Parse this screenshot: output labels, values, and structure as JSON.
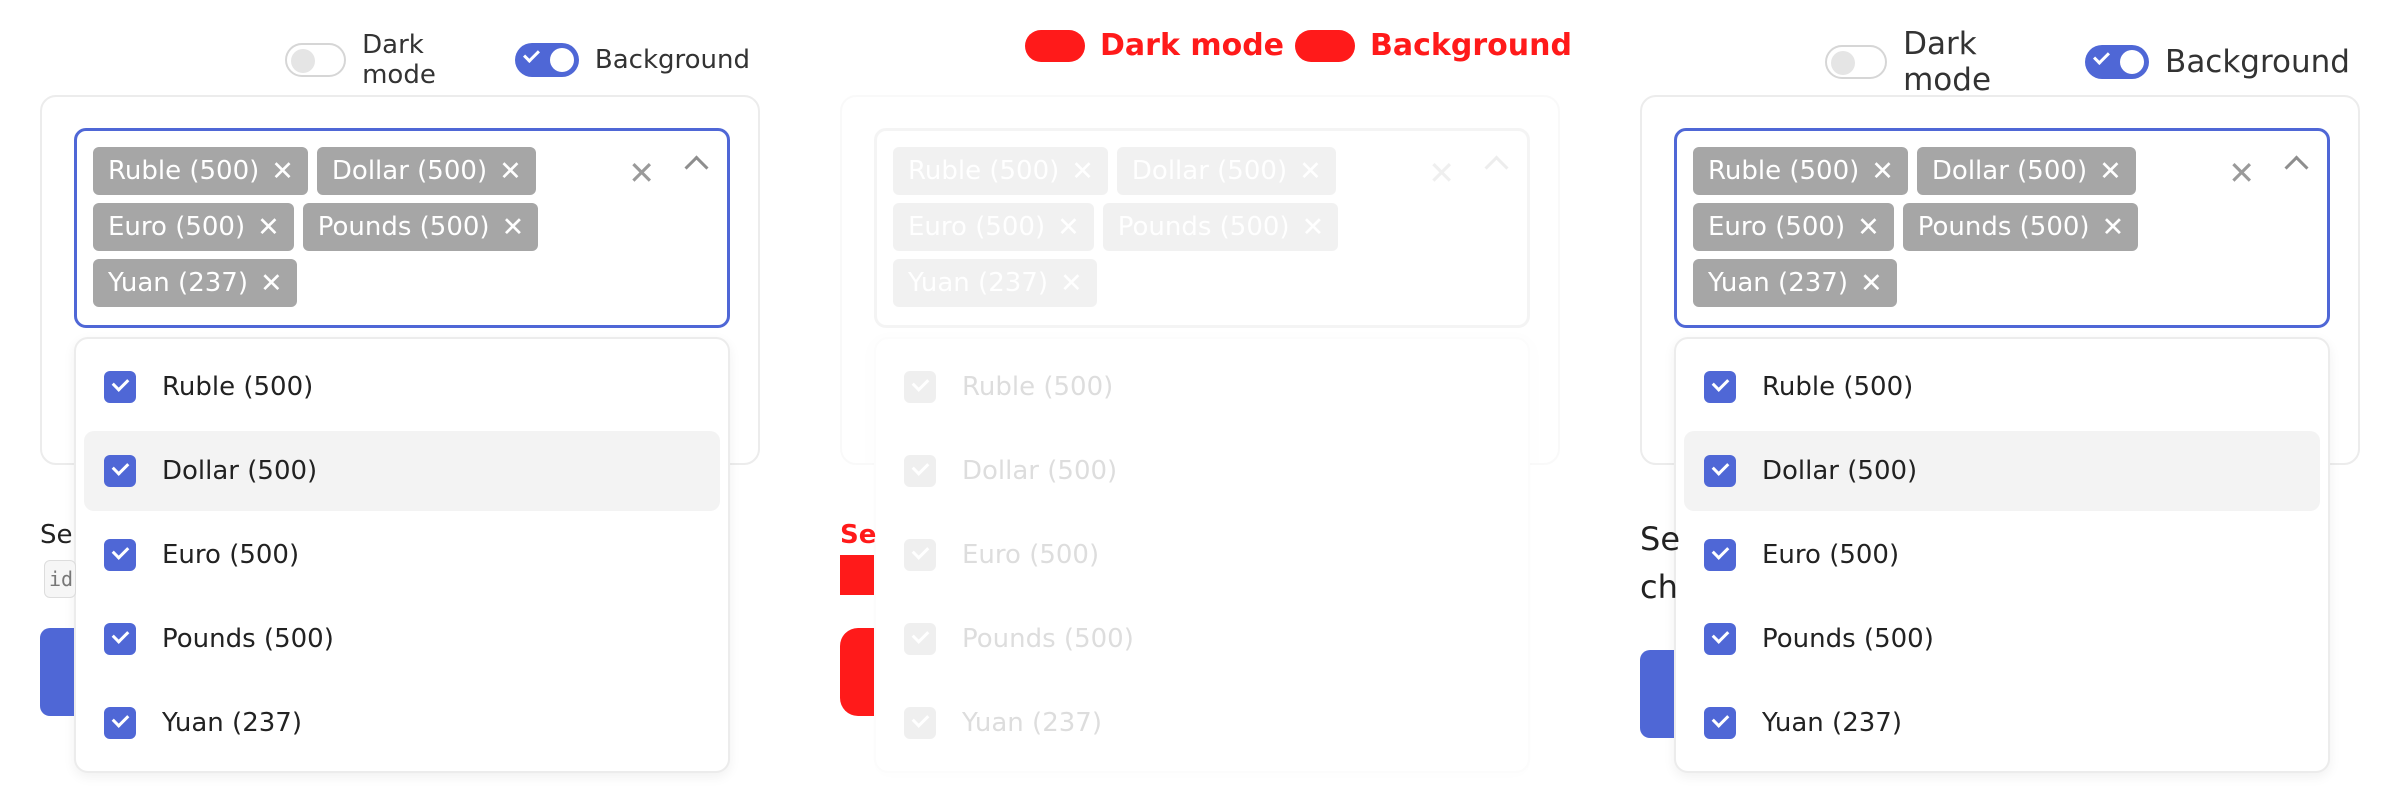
{
  "toggles": {
    "dark_mode_label": "Dark mode",
    "background_label": "Background",
    "dark_mode_on": false,
    "background_on": true
  },
  "select": {
    "tags": [
      {
        "label": "Ruble (500)"
      },
      {
        "label": "Dollar (500)"
      },
      {
        "label": "Euro (500)"
      },
      {
        "label": "Pounds (500)"
      },
      {
        "label": "Yuan (237)"
      }
    ],
    "options": [
      {
        "label": "Ruble (500)",
        "checked": true
      },
      {
        "label": "Dollar (500)",
        "checked": true,
        "highlighted": true
      },
      {
        "label": "Euro (500)",
        "checked": true
      },
      {
        "label": "Pounds (500)",
        "checked": true
      },
      {
        "label": "Yuan (237)",
        "checked": true
      }
    ]
  },
  "partial": {
    "left_text": "Se",
    "left_code": "id",
    "right_text_1": "Se",
    "right_text_2": "ch"
  },
  "colors": {
    "accent": "#4f67d6",
    "tag_bg": "#a6a6a6",
    "highlight": "#f3f3f3",
    "overlay_red": "#ff1a1a"
  }
}
